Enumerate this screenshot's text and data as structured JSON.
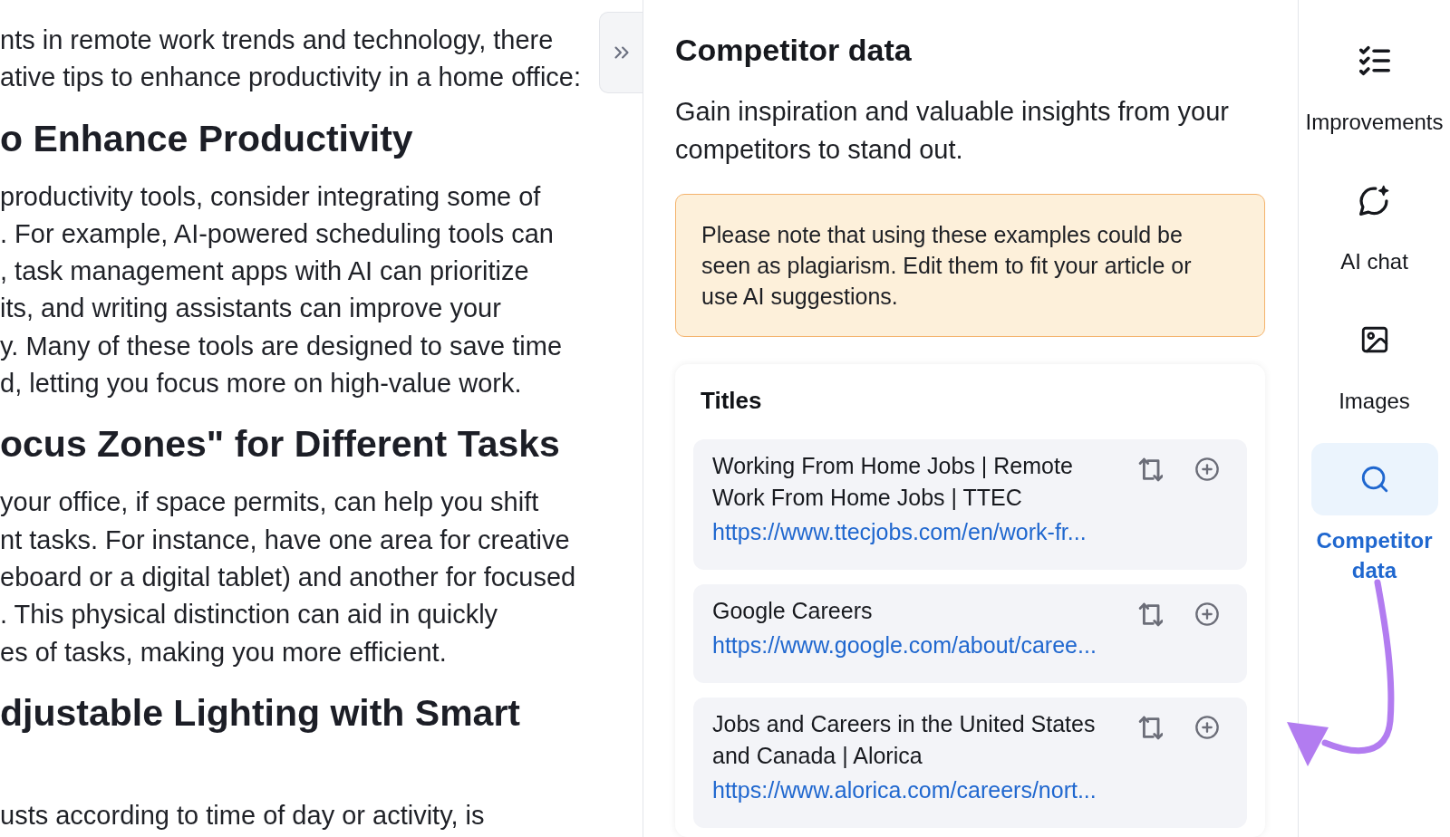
{
  "editor": {
    "blocks": [
      {
        "kind": "paragraph",
        "lines": [
          "nts in remote work trends and technology, there",
          "ative tips to enhance productivity in a home office:"
        ]
      },
      {
        "kind": "heading",
        "lines": [
          "o Enhance Productivity"
        ]
      },
      {
        "kind": "paragraph",
        "lines": [
          "productivity tools, consider integrating some of",
          ". For example, AI-powered scheduling tools can",
          ", task management apps with AI can prioritize",
          "its, and writing assistants can improve your",
          "y. Many of these tools are designed to save time",
          "d, letting you focus more on high-value work."
        ]
      },
      {
        "kind": "heading",
        "lines": [
          "ocus Zones\" for Different Tasks"
        ]
      },
      {
        "kind": "paragraph",
        "lines": [
          "your office, if space permits, can help you shift",
          "nt tasks. For instance, have one area for creative",
          "eboard or a digital tablet) and another for focused",
          ". This physical distinction can aid in quickly",
          "es of tasks, making you more efficient."
        ]
      },
      {
        "kind": "heading",
        "lines": [
          "djustable Lighting with Smart"
        ]
      },
      {
        "kind": "paragraph",
        "lines": [
          "usts according to time of day or activity, is"
        ]
      }
    ]
  },
  "panel": {
    "title": "Competitor data",
    "description": "Gain inspiration and valuable insights from your competitors to stand out.",
    "notice": "Please note that using these examples could be seen as plagiarism. Edit them to fit your article or use AI suggestions.",
    "titles_card": {
      "heading": "Titles",
      "items": [
        {
          "title": "Working From Home Jobs | Remote Work From Home Jobs | TTEC",
          "url": "https://www.ttecjobs.com/en/work-fr..."
        },
        {
          "title": "Google Careers",
          "url": "https://www.google.com/about/caree..."
        },
        {
          "title": "Jobs and Careers in the United States and Canada | Alorica",
          "url": "https://www.alorica.com/careers/nort..."
        }
      ]
    }
  },
  "sidebar": {
    "items": [
      {
        "label": "Improvements",
        "selected": false
      },
      {
        "label": "AI chat",
        "selected": false
      },
      {
        "label": "Images",
        "selected": false
      },
      {
        "label": "Competitor data",
        "selected": true
      }
    ]
  }
}
